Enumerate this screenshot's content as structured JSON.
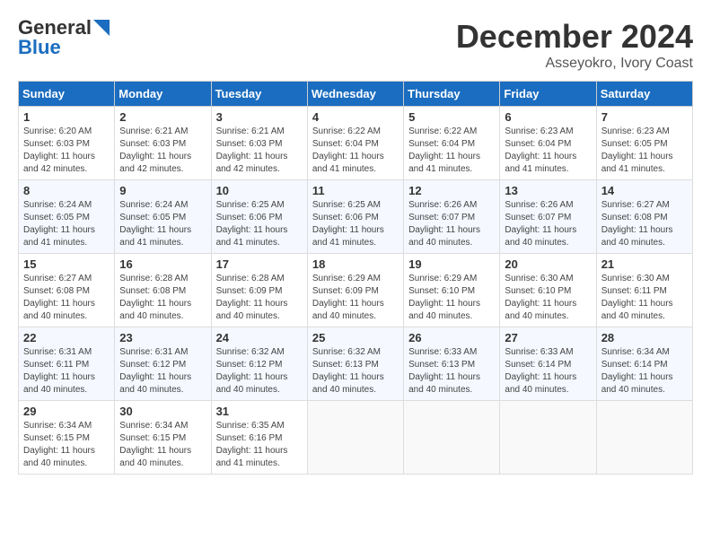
{
  "logo": {
    "general": "General",
    "blue": "Blue"
  },
  "title": "December 2024",
  "location": "Asseyokro, Ivory Coast",
  "days_of_week": [
    "Sunday",
    "Monday",
    "Tuesday",
    "Wednesday",
    "Thursday",
    "Friday",
    "Saturday"
  ],
  "weeks": [
    [
      {
        "day": "1",
        "sunrise": "6:20 AM",
        "sunset": "6:03 PM",
        "daylight": "11 hours and 42 minutes."
      },
      {
        "day": "2",
        "sunrise": "6:21 AM",
        "sunset": "6:03 PM",
        "daylight": "11 hours and 42 minutes."
      },
      {
        "day": "3",
        "sunrise": "6:21 AM",
        "sunset": "6:03 PM",
        "daylight": "11 hours and 42 minutes."
      },
      {
        "day": "4",
        "sunrise": "6:22 AM",
        "sunset": "6:04 PM",
        "daylight": "11 hours and 41 minutes."
      },
      {
        "day": "5",
        "sunrise": "6:22 AM",
        "sunset": "6:04 PM",
        "daylight": "11 hours and 41 minutes."
      },
      {
        "day": "6",
        "sunrise": "6:23 AM",
        "sunset": "6:04 PM",
        "daylight": "11 hours and 41 minutes."
      },
      {
        "day": "7",
        "sunrise": "6:23 AM",
        "sunset": "6:05 PM",
        "daylight": "11 hours and 41 minutes."
      }
    ],
    [
      {
        "day": "8",
        "sunrise": "6:24 AM",
        "sunset": "6:05 PM",
        "daylight": "11 hours and 41 minutes."
      },
      {
        "day": "9",
        "sunrise": "6:24 AM",
        "sunset": "6:05 PM",
        "daylight": "11 hours and 41 minutes."
      },
      {
        "day": "10",
        "sunrise": "6:25 AM",
        "sunset": "6:06 PM",
        "daylight": "11 hours and 41 minutes."
      },
      {
        "day": "11",
        "sunrise": "6:25 AM",
        "sunset": "6:06 PM",
        "daylight": "11 hours and 41 minutes."
      },
      {
        "day": "12",
        "sunrise": "6:26 AM",
        "sunset": "6:07 PM",
        "daylight": "11 hours and 40 minutes."
      },
      {
        "day": "13",
        "sunrise": "6:26 AM",
        "sunset": "6:07 PM",
        "daylight": "11 hours and 40 minutes."
      },
      {
        "day": "14",
        "sunrise": "6:27 AM",
        "sunset": "6:08 PM",
        "daylight": "11 hours and 40 minutes."
      }
    ],
    [
      {
        "day": "15",
        "sunrise": "6:27 AM",
        "sunset": "6:08 PM",
        "daylight": "11 hours and 40 minutes."
      },
      {
        "day": "16",
        "sunrise": "6:28 AM",
        "sunset": "6:08 PM",
        "daylight": "11 hours and 40 minutes."
      },
      {
        "day": "17",
        "sunrise": "6:28 AM",
        "sunset": "6:09 PM",
        "daylight": "11 hours and 40 minutes."
      },
      {
        "day": "18",
        "sunrise": "6:29 AM",
        "sunset": "6:09 PM",
        "daylight": "11 hours and 40 minutes."
      },
      {
        "day": "19",
        "sunrise": "6:29 AM",
        "sunset": "6:10 PM",
        "daylight": "11 hours and 40 minutes."
      },
      {
        "day": "20",
        "sunrise": "6:30 AM",
        "sunset": "6:10 PM",
        "daylight": "11 hours and 40 minutes."
      },
      {
        "day": "21",
        "sunrise": "6:30 AM",
        "sunset": "6:11 PM",
        "daylight": "11 hours and 40 minutes."
      }
    ],
    [
      {
        "day": "22",
        "sunrise": "6:31 AM",
        "sunset": "6:11 PM",
        "daylight": "11 hours and 40 minutes."
      },
      {
        "day": "23",
        "sunrise": "6:31 AM",
        "sunset": "6:12 PM",
        "daylight": "11 hours and 40 minutes."
      },
      {
        "day": "24",
        "sunrise": "6:32 AM",
        "sunset": "6:12 PM",
        "daylight": "11 hours and 40 minutes."
      },
      {
        "day": "25",
        "sunrise": "6:32 AM",
        "sunset": "6:13 PM",
        "daylight": "11 hours and 40 minutes."
      },
      {
        "day": "26",
        "sunrise": "6:33 AM",
        "sunset": "6:13 PM",
        "daylight": "11 hours and 40 minutes."
      },
      {
        "day": "27",
        "sunrise": "6:33 AM",
        "sunset": "6:14 PM",
        "daylight": "11 hours and 40 minutes."
      },
      {
        "day": "28",
        "sunrise": "6:34 AM",
        "sunset": "6:14 PM",
        "daylight": "11 hours and 40 minutes."
      }
    ],
    [
      {
        "day": "29",
        "sunrise": "6:34 AM",
        "sunset": "6:15 PM",
        "daylight": "11 hours and 40 minutes."
      },
      {
        "day": "30",
        "sunrise": "6:34 AM",
        "sunset": "6:15 PM",
        "daylight": "11 hours and 40 minutes."
      },
      {
        "day": "31",
        "sunrise": "6:35 AM",
        "sunset": "6:16 PM",
        "daylight": "11 hours and 41 minutes."
      },
      null,
      null,
      null,
      null
    ]
  ]
}
